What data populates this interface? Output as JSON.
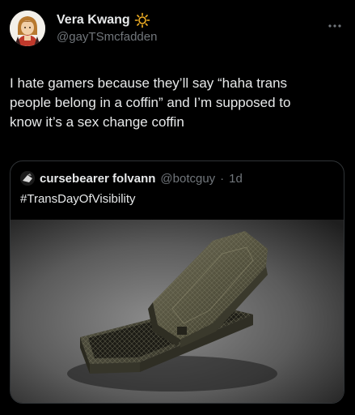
{
  "tweet": {
    "display_name": "Vera Kwang",
    "handle": "@gayTSmcfadden",
    "text_lines": [
      "I hate gamers because they’ll say “haha trans",
      "people belong in a coffin” and I’m supposed to",
      "know it’s a sex change coffin"
    ],
    "icons": {
      "badge": "sun-icon",
      "menu": "more-icon",
      "avatar": "avatar-illustration"
    }
  },
  "quote": {
    "display_name": "cursebearer folvann",
    "handle": "@botcguy",
    "separator": "·",
    "time": "1d",
    "text": "#TransDayOfVisibility",
    "media_description_icon": "coffin-image"
  },
  "colors": {
    "background": "#000000",
    "text": "#e7e9ea",
    "secondary": "#71767b",
    "border": "#2f3336",
    "sun_badge": "#f2b024"
  }
}
